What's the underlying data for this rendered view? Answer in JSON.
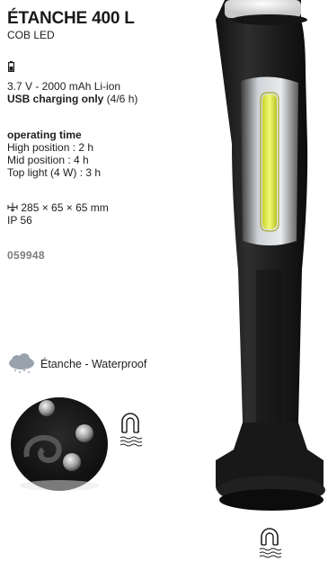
{
  "product": {
    "title": "ÉTANCHE 400 L",
    "subtitle": "COB LED",
    "battery_icon": "battery-icon",
    "battery_line": "3.7 V - 2000 mAh Li-ion",
    "charging_bold": "USB charging only",
    "charging_time": " (4/6 h)",
    "operating_title": "operating time",
    "operating_high": "High position : 2 h",
    "operating_mid": "Mid position : 4 h",
    "operating_top": "Top light (4 W) : 3 h",
    "dimension_icon": "dimension-icon",
    "dimensions": "285 × 65 × 65 mm",
    "ip_rating": "IP 56",
    "sku": "059948",
    "waterproof_icon": "rain-cloud-icon",
    "waterproof_label": "Étanche - Waterproof",
    "magnet_icon": "magnet-icon"
  },
  "colors": {
    "text": "#1e1e1e",
    "sku_gray": "#7d7d7d",
    "torch_body": "#202020",
    "cob_yellow": "#e6f03c",
    "cloud_gray": "#9aa3ad"
  }
}
